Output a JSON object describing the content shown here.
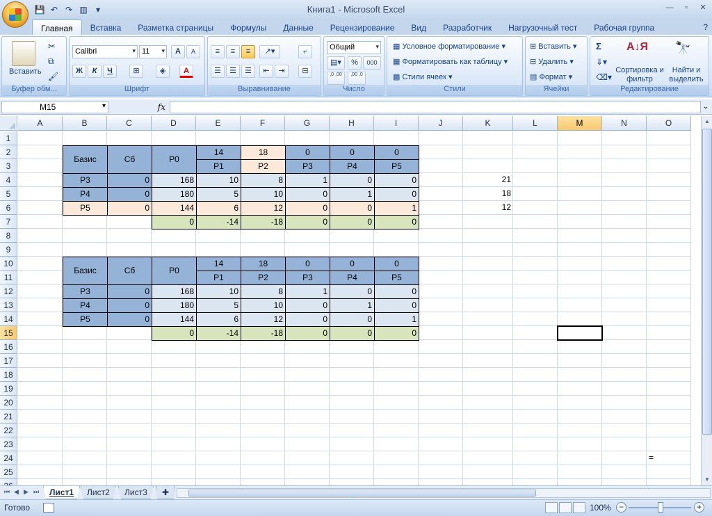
{
  "window": {
    "title": "Книга1 - Microsoft Excel",
    "controls": [
      "—",
      "▫",
      "✕"
    ]
  },
  "quick_access": [
    "save-icon",
    "undo-icon",
    "redo-icon",
    "chart-icon",
    "customize-icon"
  ],
  "tabs": [
    "Главная",
    "Вставка",
    "Разметка страницы",
    "Формулы",
    "Данные",
    "Рецензирование",
    "Вид",
    "Разработчик",
    "Нагрузочный тест",
    "Рабочая группа"
  ],
  "active_tab": "Главная",
  "ribbon": {
    "clipboard": {
      "label": "Буфер обм...",
      "paste": "Вставить"
    },
    "font": {
      "label": "Шрифт",
      "name": "Calibri",
      "size": "11",
      "bold": "Ж",
      "italic": "К",
      "underline": "Ч",
      "grow": "A",
      "shrink": "A",
      "font_color": "A"
    },
    "alignment": {
      "label": "Выравнивание"
    },
    "number": {
      "label": "Число",
      "format": "Общий",
      "percent": "%",
      "thousands": "000",
      "inc_dec": ",0 ,00",
      "dec_dec": ",00 ,0"
    },
    "styles": {
      "label": "Стили",
      "conditional": "Условное форматирование",
      "as_table": "Форматировать как таблицу",
      "cell_styles": "Стили ячеек"
    },
    "cells": {
      "label": "Ячейки",
      "insert": "Вставить",
      "delete": "Удалить",
      "format": "Формат"
    },
    "editing": {
      "label": "Редактирование",
      "sigma": "Σ",
      "sort": "Сортировка и фильтр",
      "find": "Найти и выделить"
    }
  },
  "formula_bar": {
    "name_box": "M15",
    "fx": "fx",
    "formula": ""
  },
  "columns": [
    "A",
    "B",
    "C",
    "D",
    "E",
    "F",
    "G",
    "H",
    "I",
    "J",
    "K",
    "L",
    "M",
    "N",
    "O"
  ],
  "rows": [
    "1",
    "2",
    "3",
    "4",
    "5",
    "6",
    "7",
    "8",
    "9",
    "10",
    "11",
    "12",
    "13",
    "14",
    "15",
    "16",
    "17",
    "18",
    "19",
    "20",
    "21",
    "22",
    "23",
    "24",
    "25",
    "26"
  ],
  "selected_column": "M",
  "selected_row": "15",
  "table1": {
    "header_basis": "Базис",
    "header_cb": "Сб",
    "header_p0": "P0",
    "coeffs": [
      "14",
      "18",
      "0",
      "0",
      "0"
    ],
    "vars": [
      "P1",
      "P2",
      "P3",
      "P4",
      "P5"
    ],
    "rows": [
      {
        "basis": "P3",
        "cb": "0",
        "p0": "168",
        "vals": [
          "10",
          "8",
          "1",
          "0",
          "0"
        ],
        "k": "21"
      },
      {
        "basis": "P4",
        "cb": "0",
        "p0": "180",
        "vals": [
          "5",
          "10",
          "0",
          "1",
          "0"
        ],
        "k": "18"
      },
      {
        "basis": "P5",
        "cb": "0",
        "p0": "144",
        "vals": [
          "6",
          "12",
          "0",
          "0",
          "1"
        ],
        "k": "12"
      }
    ],
    "delta": {
      "p0": "0",
      "vals": [
        "-14",
        "-18",
        "0",
        "0",
        "0"
      ]
    }
  },
  "table2": {
    "header_basis": "Базис",
    "header_cb": "Сб",
    "header_p0": "P0",
    "coeffs": [
      "14",
      "18",
      "0",
      "0",
      "0"
    ],
    "vars": [
      "P1",
      "P2",
      "P3",
      "P4",
      "P5"
    ],
    "rows": [
      {
        "basis": "P3",
        "cb": "0",
        "p0": "168",
        "vals": [
          "10",
          "8",
          "1",
          "0",
          "0"
        ]
      },
      {
        "basis": "P4",
        "cb": "0",
        "p0": "180",
        "vals": [
          "5",
          "10",
          "0",
          "1",
          "0"
        ]
      },
      {
        "basis": "P5",
        "cb": "0",
        "p0": "144",
        "vals": [
          "6",
          "12",
          "0",
          "0",
          "1"
        ]
      }
    ],
    "delta": {
      "p0": "0",
      "vals": [
        "-14",
        "-18",
        "0",
        "0",
        "0"
      ]
    }
  },
  "stray_cell": {
    "ref": "O24",
    "value": "="
  },
  "sheets": [
    "Лист1",
    "Лист2",
    "Лист3"
  ],
  "active_sheet": "Лист1",
  "status": {
    "ready": "Готово",
    "zoom": "100%"
  }
}
